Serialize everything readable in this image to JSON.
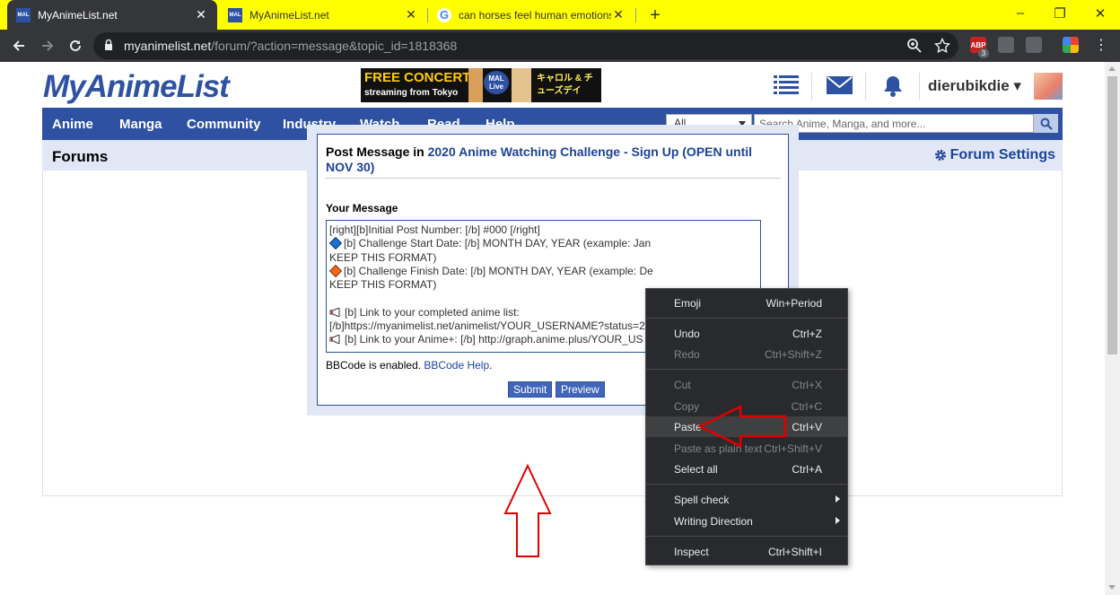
{
  "browser": {
    "tabs": [
      {
        "favicon": "MAL",
        "title": "MyAnimeList.net",
        "active": true
      },
      {
        "favicon": "MAL",
        "title": "MyAnimeList.net",
        "active": false
      },
      {
        "favicon": "G",
        "title": "can horses feel human emotions",
        "active": false
      }
    ],
    "new_tab_symbol": "+",
    "window_controls": {
      "minimize": "–",
      "maximize": "❐",
      "close": "✕"
    },
    "url_host": "myanimelist.net",
    "url_path": "/forum/?action=message&topic_id=1818368",
    "extension_badge": "3"
  },
  "site": {
    "logo": "MyAnimeList",
    "banner": {
      "line1": "FREE CONCERT",
      "line2": "streaming from Tokyo",
      "mal_badge": "MAL Live",
      "jp_text": "キャロル & チューズデイ"
    },
    "username": "dierubikdie",
    "user_caret": "▾",
    "nav": [
      "Anime",
      "Manga",
      "Community",
      "Industry",
      "Watch",
      "Read",
      "Help"
    ],
    "search_category": "All",
    "search_placeholder": "Search Anime, Manga, and more...",
    "section_title": "Forums",
    "forum_settings": "Forum Settings"
  },
  "post": {
    "title_prefix": "Post Message in",
    "topic_title": "2020 Anime Watching Challenge - Sign Up (OPEN until NOV 30)",
    "message_label": "Your Message",
    "message_lines": [
      "[right][b]Initial Post Number: [/b] #000 [/right]",
      "[b] Challenge Start Date: [/b] MONTH DAY, YEAR (example: Jan",
      "KEEP THIS FORMAT)",
      "[b] Challenge Finish Date: [/b] MONTH DAY, YEAR (example: De",
      "KEEP THIS FORMAT)",
      "",
      "[b] Link to your completed anime list:",
      "[/b]https://myanimelist.net/animelist/YOUR_USERNAME?status=2",
      "[b] Link to your Anime+: [/b] http://graph.anime.plus/YOUR_US"
    ],
    "bbcode_text": "BBCode is enabled.",
    "bbcode_link": "BBCode Help",
    "bbcode_period": ".",
    "submit": "Submit",
    "preview": "Preview"
  },
  "context_menu": {
    "items": [
      {
        "label": "Emoji",
        "shortcut": "Win+Period",
        "disabled": false
      },
      {
        "label": "Undo",
        "shortcut": "Ctrl+Z",
        "disabled": false
      },
      {
        "label": "Redo",
        "shortcut": "Ctrl+Shift+Z",
        "disabled": true
      },
      {
        "label": "Cut",
        "shortcut": "Ctrl+X",
        "disabled": true
      },
      {
        "label": "Copy",
        "shortcut": "Ctrl+C",
        "disabled": true
      },
      {
        "label": "Paste",
        "shortcut": "Ctrl+V",
        "disabled": false
      },
      {
        "label": "Paste as plain text",
        "shortcut": "Ctrl+Shift+V",
        "disabled": true
      },
      {
        "label": "Select all",
        "shortcut": "Ctrl+A",
        "disabled": false
      },
      {
        "label": "Spell check",
        "shortcut": "",
        "disabled": false
      },
      {
        "label": "Writing Direction",
        "shortcut": "",
        "disabled": false
      },
      {
        "label": "Inspect",
        "shortcut": "Ctrl+Shift+I",
        "disabled": false
      }
    ]
  },
  "colors": {
    "brand": "#2e51a2",
    "link": "#1c439b",
    "tab_bar": "#ffff00",
    "annotation_arrow": "#e00000"
  },
  "icons": [
    "lock-icon",
    "zoom-icon",
    "star-icon",
    "list-icon",
    "mail-icon",
    "bell-icon",
    "search-icon",
    "gear-icon",
    "diamond-blue-icon",
    "diamond-orange-icon",
    "megaphone-icon",
    "annotation-arrow-up",
    "annotation-arrow-left"
  ]
}
